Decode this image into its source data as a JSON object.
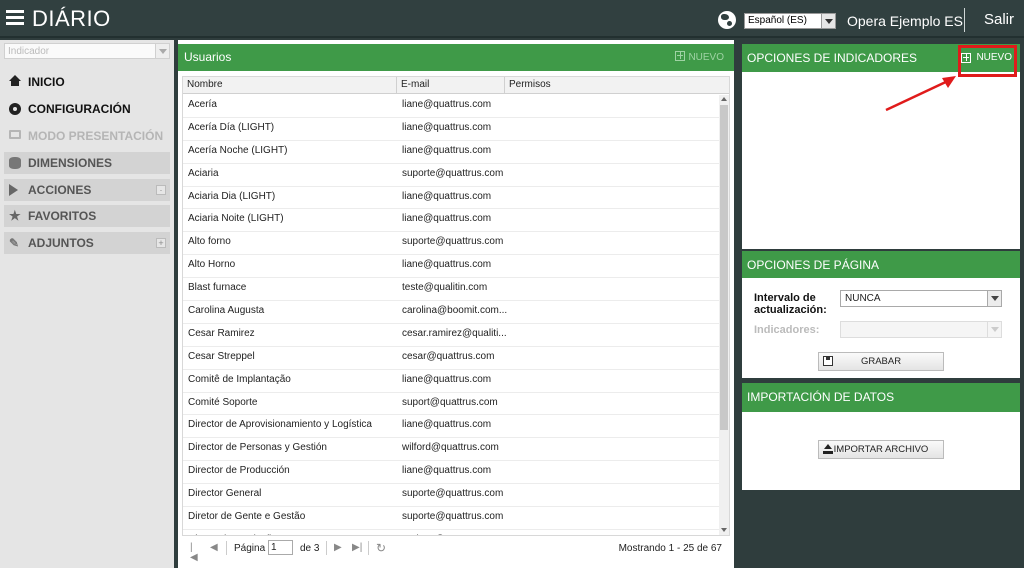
{
  "app": {
    "title": "DIÁRIO",
    "language": "Español (ES)",
    "company": "Opera Ejemplo ES",
    "logout": "Salir"
  },
  "sidebar": {
    "indicator_placeholder": "Indicador",
    "items": [
      {
        "label": "INICIO",
        "icon": "home-icon"
      },
      {
        "label": "CONFIGURACIÓN",
        "icon": "gear-icon"
      },
      {
        "label": "MODO PRESENTACIÓN",
        "icon": "monitor-icon"
      },
      {
        "label": "DIMENSIONES",
        "icon": "database-icon"
      },
      {
        "label": "ACCIONES",
        "icon": "play-icon"
      },
      {
        "label": "FAVORITOS",
        "icon": "star-icon"
      },
      {
        "label": "ADJUNTOS",
        "icon": "paperclip-icon"
      }
    ]
  },
  "users": {
    "title": "Usuarios",
    "new_label": "NUEVO",
    "columns": [
      "Nombre",
      "E-mail",
      "Permisos"
    ],
    "rows": [
      {
        "name": "Acería",
        "email": "liane@quattrus.com"
      },
      {
        "name": "Acería Día (LIGHT)",
        "email": "liane@quattrus.com"
      },
      {
        "name": "Acería Noche (LIGHT)",
        "email": "liane@quattrus.com"
      },
      {
        "name": "Aciaria",
        "email": "suporte@quattrus.com"
      },
      {
        "name": "Aciaria Dia (LIGHT)",
        "email": "liane@quattrus.com"
      },
      {
        "name": "Aciaria Noite (LIGHT)",
        "email": "liane@quattrus.com"
      },
      {
        "name": "Alto forno",
        "email": "suporte@quattrus.com"
      },
      {
        "name": "Alto Horno",
        "email": "liane@quattrus.com"
      },
      {
        "name": "Blast furnace",
        "email": "teste@qualitin.com"
      },
      {
        "name": "Carolina Augusta",
        "email": "carolina@boomit.com..."
      },
      {
        "name": "Cesar Ramirez",
        "email": "cesar.ramirez@qualiti..."
      },
      {
        "name": "Cesar Streppel",
        "email": "cesar@quattrus.com"
      },
      {
        "name": "Comitê de Implantação",
        "email": "liane@quattrus.com"
      },
      {
        "name": "Comité Soporte",
        "email": "suport@quattrus.com"
      },
      {
        "name": "Director de Aprovisionamiento y Logística",
        "email": "liane@quattrus.com"
      },
      {
        "name": "Director de Personas y Gestión",
        "email": "wilford@quattrus.com"
      },
      {
        "name": "Director de Producción",
        "email": "liane@quattrus.com"
      },
      {
        "name": "Director General",
        "email": "suporte@quattrus.com"
      },
      {
        "name": "Diretor de Gente e Gestão",
        "email": "suporte@quattrus.com"
      },
      {
        "name": "Diretor de Produção",
        "email": "andrew@quattrus.com"
      }
    ],
    "pager": {
      "page_label": "Página",
      "page_value": "1",
      "of_label": "de 3",
      "showing": "Mostrando 1 - 25 de 67"
    }
  },
  "indicator_options": {
    "title": "OPCIONES DE INDICADORES",
    "new_label": "NUEVO"
  },
  "page_options": {
    "title": "OPCIONES DE PÁGINA",
    "refresh_label": "Intervalo de actualización:",
    "refresh_value": "NUNCA",
    "indicators_label": "Indicadores:",
    "indicators_value": "",
    "save_label": "GRABAR"
  },
  "data_import": {
    "title": "IMPORTACIÓN DE DATOS",
    "import_label": "IMPORTAR ARCHIVO"
  },
  "colors": {
    "header_bg": "#314040",
    "panel_green": "#3f9a48",
    "highlight_red": "#e01b1b"
  }
}
